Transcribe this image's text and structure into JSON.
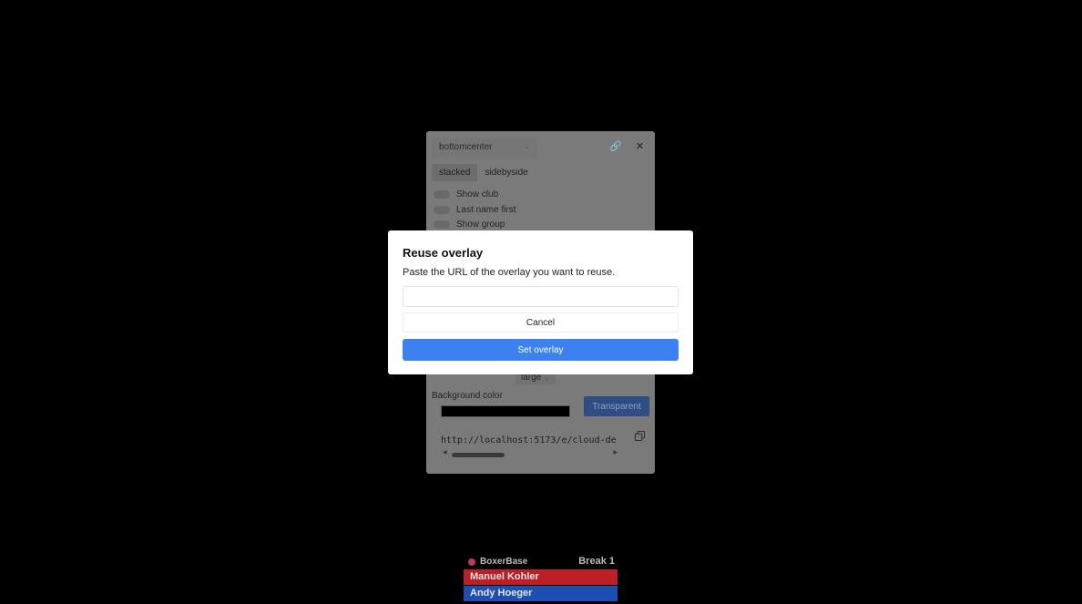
{
  "panel": {
    "position_select": "bottomcenter",
    "tabs": [
      "stacked",
      "sidebyside"
    ],
    "toggles": [
      {
        "label": "Show club"
      },
      {
        "label": "Last name first"
      },
      {
        "label": "Show group"
      }
    ],
    "size_select": "large",
    "background_color_label": "Background color",
    "transparent_label": "Transparent",
    "overlay_url": "http://localhost:5173/e/cloud-de"
  },
  "modal": {
    "title": "Reuse overlay",
    "description": "Paste the URL of the overlay you want to reuse.",
    "input_value": "",
    "cancel_label": "Cancel",
    "confirm_label": "Set overlay"
  },
  "overlay": {
    "brand": "BoxerBase",
    "round": "Break 1",
    "red_corner": "Manuel Kohler",
    "blue_corner": "Andy Hoeger"
  },
  "colors": {
    "primary": "#3b82f0",
    "red_corner": "#bd1f26",
    "blue_corner": "#1d4fb3"
  }
}
